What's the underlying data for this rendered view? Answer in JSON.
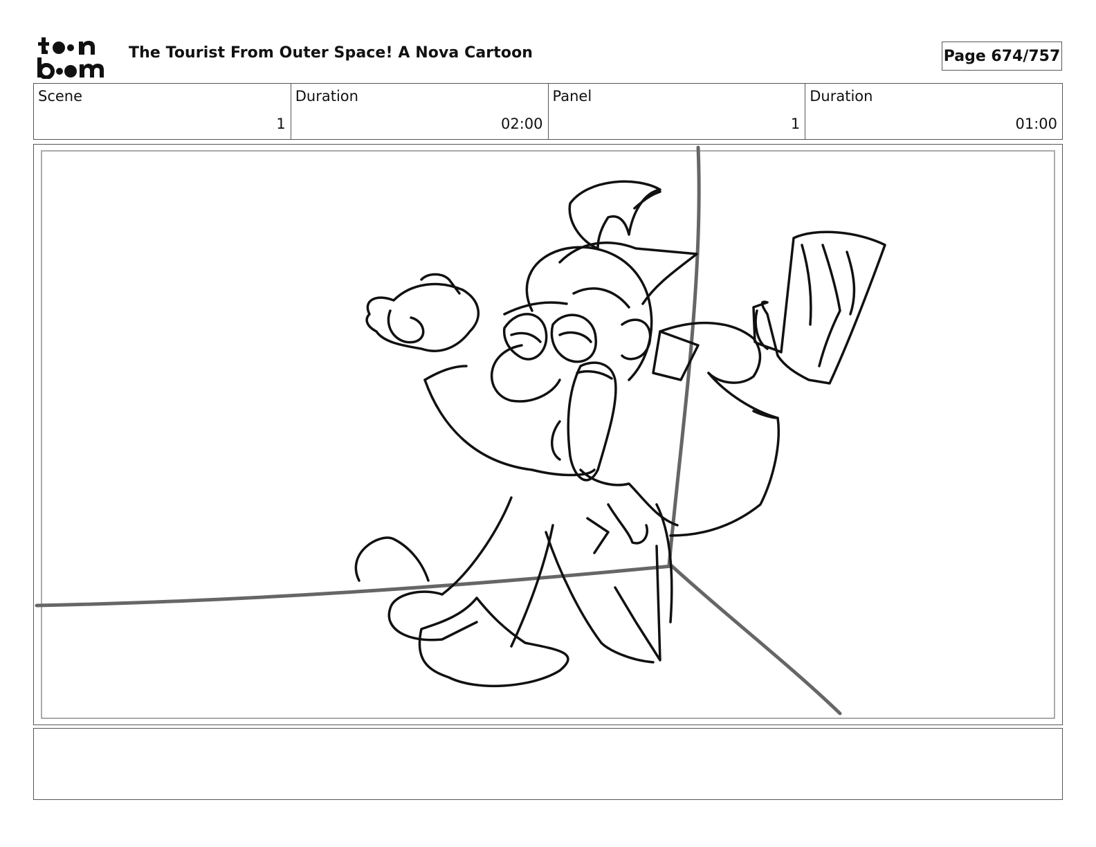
{
  "header": {
    "logo_text": "toon boom",
    "project_title": "The Tourist From Outer Space!  A Nova Cartoon",
    "page_label": "Page 674/757"
  },
  "panel_info": [
    {
      "label": "Scene",
      "value": "1"
    },
    {
      "label": "Duration",
      "value": "02:00"
    },
    {
      "label": "Panel",
      "value": "1"
    },
    {
      "label": "Duration",
      "value": "01:00"
    }
  ],
  "panel": {
    "image_icon": "storyboard-sketch",
    "colors": {
      "line": "#111111",
      "guide": "#666666",
      "frame": "#aaaaaa"
    }
  },
  "caption": {
    "text": ""
  }
}
